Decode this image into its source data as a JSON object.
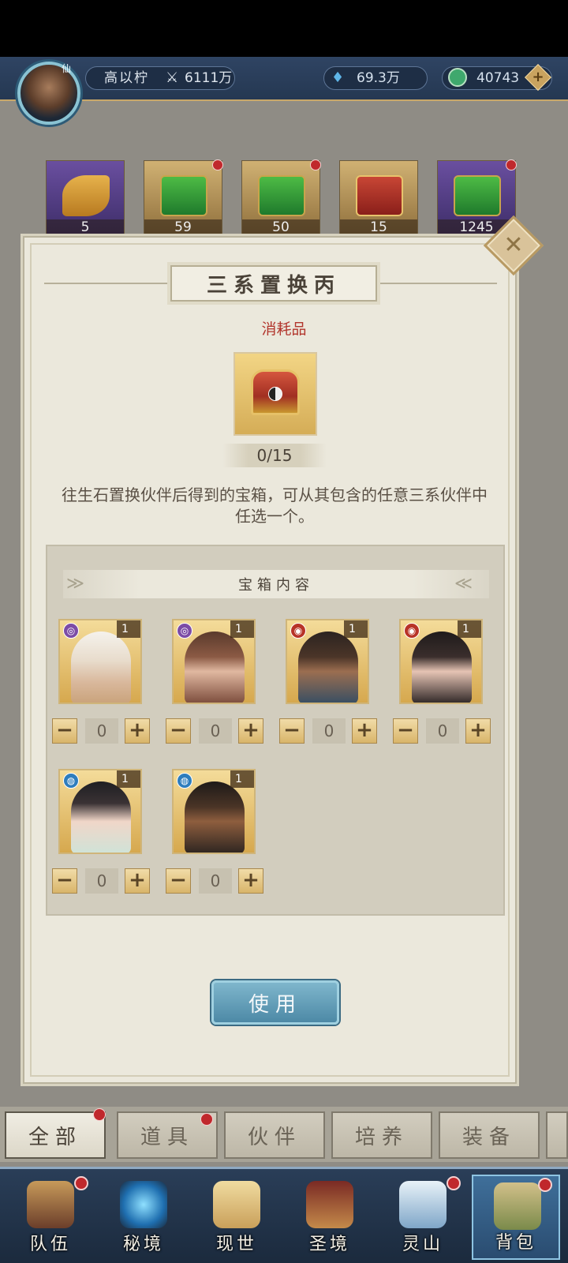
{
  "header": {
    "player_name": "高以柠",
    "power": "6111万",
    "gems": "69.3万",
    "coins": "40743",
    "avatar_badge": "仙"
  },
  "inventory": [
    {
      "count": "5",
      "has_dot": false
    },
    {
      "count": "59",
      "has_dot": true
    },
    {
      "count": "50",
      "has_dot": true
    },
    {
      "count": "15",
      "has_dot": false
    },
    {
      "count": "1245",
      "has_dot": true
    }
  ],
  "modal": {
    "title": "三系置换丙",
    "item_type": "消耗品",
    "item_count": "0/15",
    "description": "往生石置换伙伴后得到的宝箱，可从其包含的任意三系伙伴中任选一个。",
    "contents_title": "宝箱内容",
    "use_label": "使用",
    "close_icon": "✕"
  },
  "partners": [
    {
      "element": "purple",
      "level": "1",
      "qty": "0"
    },
    {
      "element": "purple",
      "level": "1",
      "qty": "0"
    },
    {
      "element": "red",
      "level": "1",
      "qty": "0"
    },
    {
      "element": "red",
      "level": "1",
      "qty": "0"
    },
    {
      "element": "blue",
      "level": "1",
      "qty": "0"
    },
    {
      "element": "blue",
      "level": "1",
      "qty": "0"
    }
  ],
  "qty_controls": {
    "minus": "−",
    "plus": "+"
  },
  "tabs": [
    {
      "label": "全部",
      "active": true,
      "dot": true
    },
    {
      "label": "道具",
      "active": false,
      "dot": true
    },
    {
      "label": "伙伴",
      "active": false,
      "dot": false
    },
    {
      "label": "培养",
      "active": false,
      "dot": false
    },
    {
      "label": "装备",
      "active": false,
      "dot": false
    }
  ],
  "nav": [
    {
      "label": "队伍",
      "dot": true,
      "active": false
    },
    {
      "label": "秘境",
      "dot": false,
      "active": false
    },
    {
      "label": "现世",
      "dot": false,
      "active": false
    },
    {
      "label": "圣境",
      "dot": false,
      "active": false
    },
    {
      "label": "灵山",
      "dot": true,
      "active": false
    },
    {
      "label": "背包",
      "dot": true,
      "active": true
    }
  ],
  "colors": {
    "header_bg": "#2f4463",
    "modal_bg": "#ebe8dc",
    "accent_red": "#b2362d",
    "use_button": "#4d89a6"
  }
}
